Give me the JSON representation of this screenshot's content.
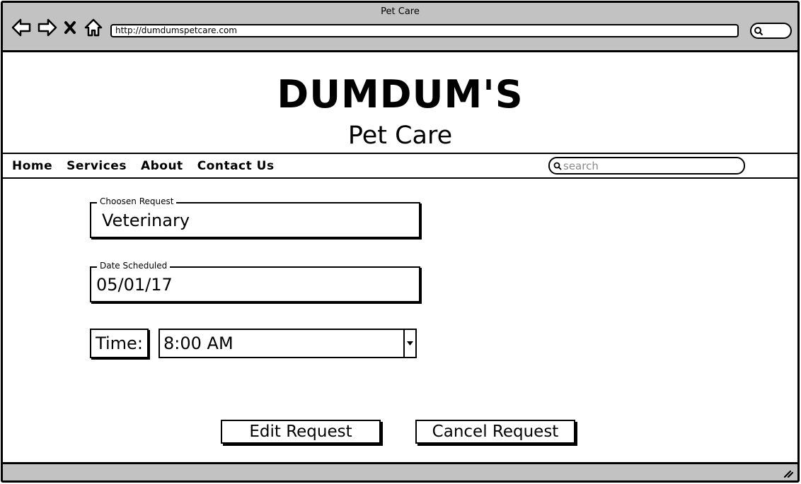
{
  "browser": {
    "title": "Pet Care",
    "url": "http://dumdumspetcare.com"
  },
  "icons": {
    "back": "arrow-left-icon",
    "forward": "arrow-right-icon",
    "stop": "close-icon",
    "home": "home-icon",
    "search": "search-icon",
    "dropdown": "chevron-down-icon",
    "resize": "resize-grip-icon"
  },
  "header": {
    "logo": "DUMDUM'S",
    "subtitle": "Pet Care"
  },
  "nav": {
    "items": [
      "Home",
      "Services",
      "About",
      "Contact Us"
    ],
    "search_placeholder": "search"
  },
  "form": {
    "request": {
      "label": "Choosen Request",
      "value": "Veterinary"
    },
    "date": {
      "label": "Date Scheduled",
      "value": "05/01/17"
    },
    "time": {
      "label": "Time:",
      "value": "8:00 AM"
    }
  },
  "actions": {
    "edit": "Edit Request",
    "cancel": "Cancel Request"
  }
}
